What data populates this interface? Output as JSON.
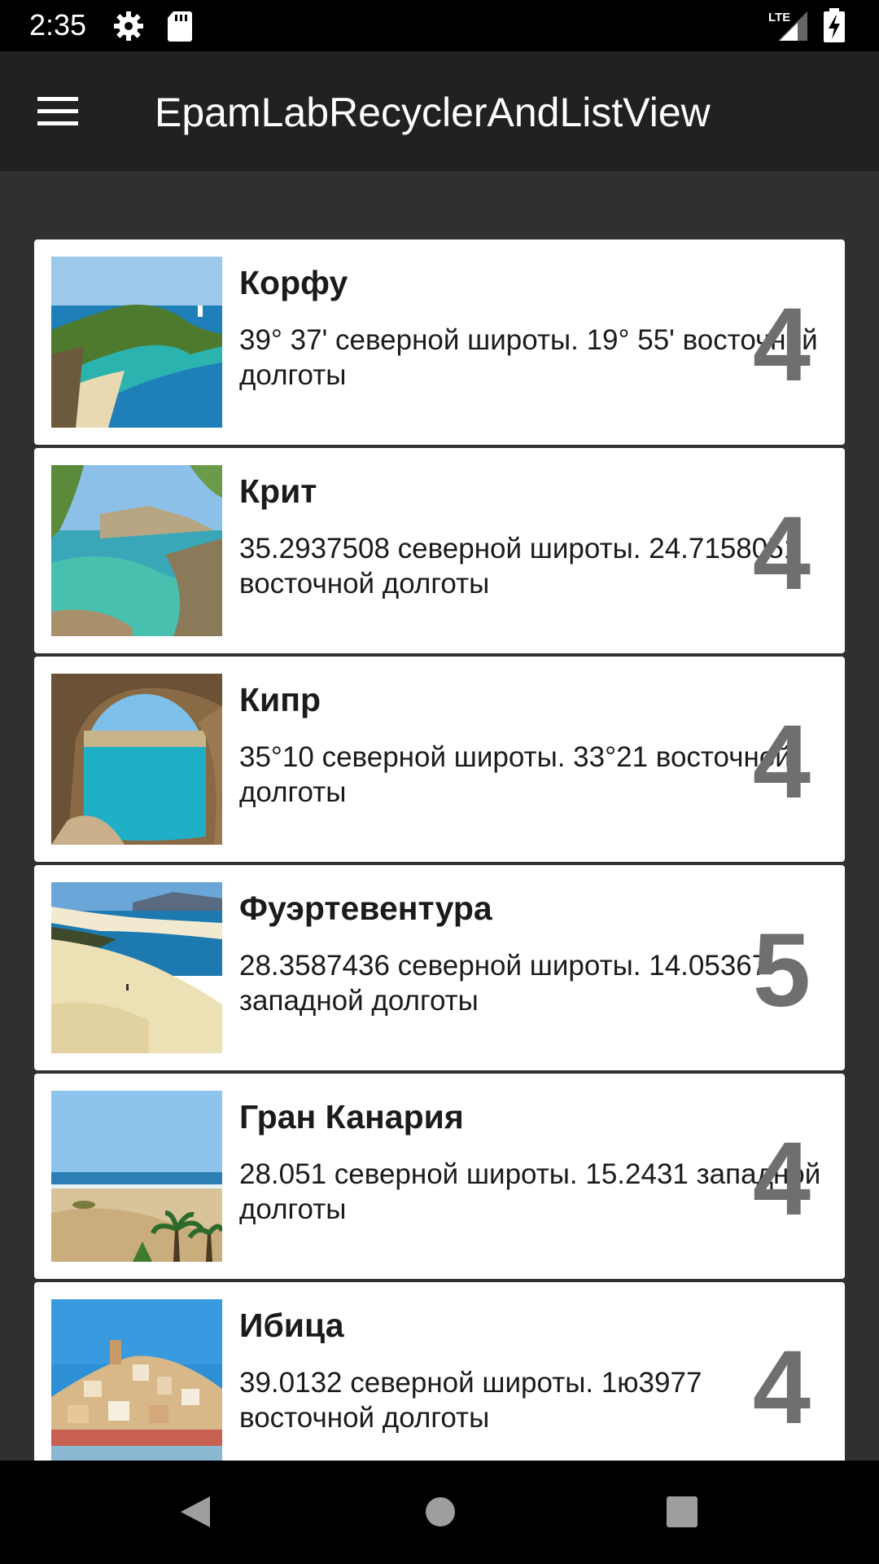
{
  "status_bar": {
    "time": "2:35",
    "icons": [
      "gear-icon",
      "sd-card-icon",
      "lte-signal-icon",
      "battery-charging-icon"
    ],
    "lte_label": "LTE"
  },
  "toolbar": {
    "title": "EpamLabRecyclerAndListView",
    "menu_icon": "hamburger-menu-icon"
  },
  "items": [
    {
      "title": "Корфу",
      "description": "39° 37' северной широты. 19° 55' восточной долготы",
      "rating": "4",
      "image": "corfu-photo"
    },
    {
      "title": "Крит",
      "description": "35.2937508 северной широты. 24.7158051 восточной долготы",
      "rating": "4",
      "image": "crete-photo"
    },
    {
      "title": "Кипр",
      "description": "35°10 северной широты. 33°21 восточной долготы",
      "rating": "4",
      "image": "cyprus-photo"
    },
    {
      "title": "Фуэртевентура",
      "description": "28.3587436 северной широты. 14.05367 западной долготы",
      "rating": "5",
      "image": "fuerteventura-photo"
    },
    {
      "title": "Гран Канария",
      "description": "28.051 северной широты. 15.2431 западной долготы",
      "rating": "4",
      "image": "gran-canaria-photo"
    },
    {
      "title": "Ибица",
      "description": "39.0132 северной широты. 1ю3977 восточной долготы",
      "rating": "4",
      "image": "ibiza-photo"
    }
  ],
  "nav_bar": {
    "buttons": [
      "back-icon",
      "home-icon",
      "recents-icon"
    ]
  },
  "colors": {
    "toolbar": "#212121",
    "background": "#303030",
    "card": "#ffffff",
    "rating": "#6f6f6f"
  }
}
